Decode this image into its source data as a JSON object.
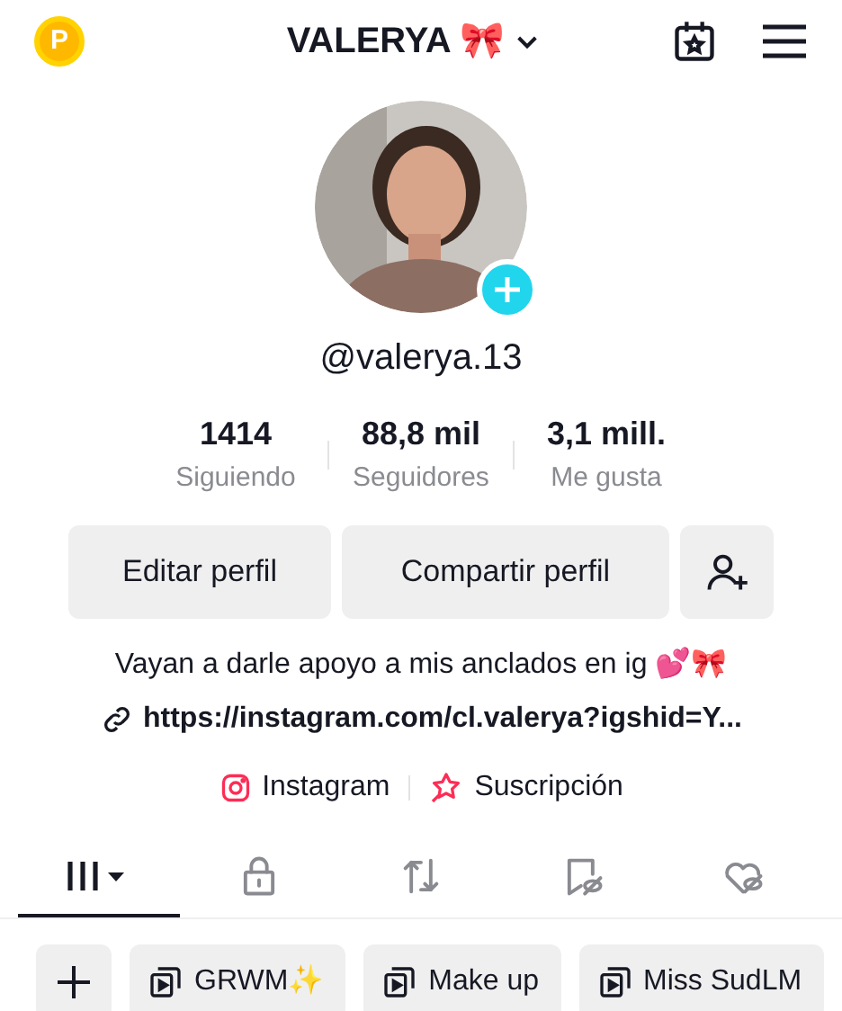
{
  "header": {
    "coin_label": "P",
    "username": "VALERYA 🎀"
  },
  "profile": {
    "handle": "@valerya.13"
  },
  "stats": [
    {
      "value": "1414",
      "label": "Siguiendo"
    },
    {
      "value": "88,8 mil",
      "label": "Seguidores"
    },
    {
      "value": "3,1 mill.",
      "label": "Me gusta"
    }
  ],
  "buttons": [
    "Editar perfil",
    "Compartir perfil"
  ],
  "bio": "Vayan a darle apoyo a mis anclados en ig 💕🎀",
  "link": "https://instagram.com/cl.valerya?igshid=Y...",
  "social": [
    {
      "kind": "instagram",
      "label": "Instagram"
    },
    {
      "kind": "subscription",
      "label": "Suscripción"
    }
  ],
  "tabs": [
    {
      "kind": "grid",
      "selected": true
    },
    {
      "kind": "private",
      "selected": false
    },
    {
      "kind": "repost",
      "selected": false
    },
    {
      "kind": "saved",
      "selected": false
    },
    {
      "kind": "liked",
      "selected": false
    }
  ],
  "playlists": [
    "GRWM✨",
    "Make up",
    "Miss SudLM"
  ]
}
